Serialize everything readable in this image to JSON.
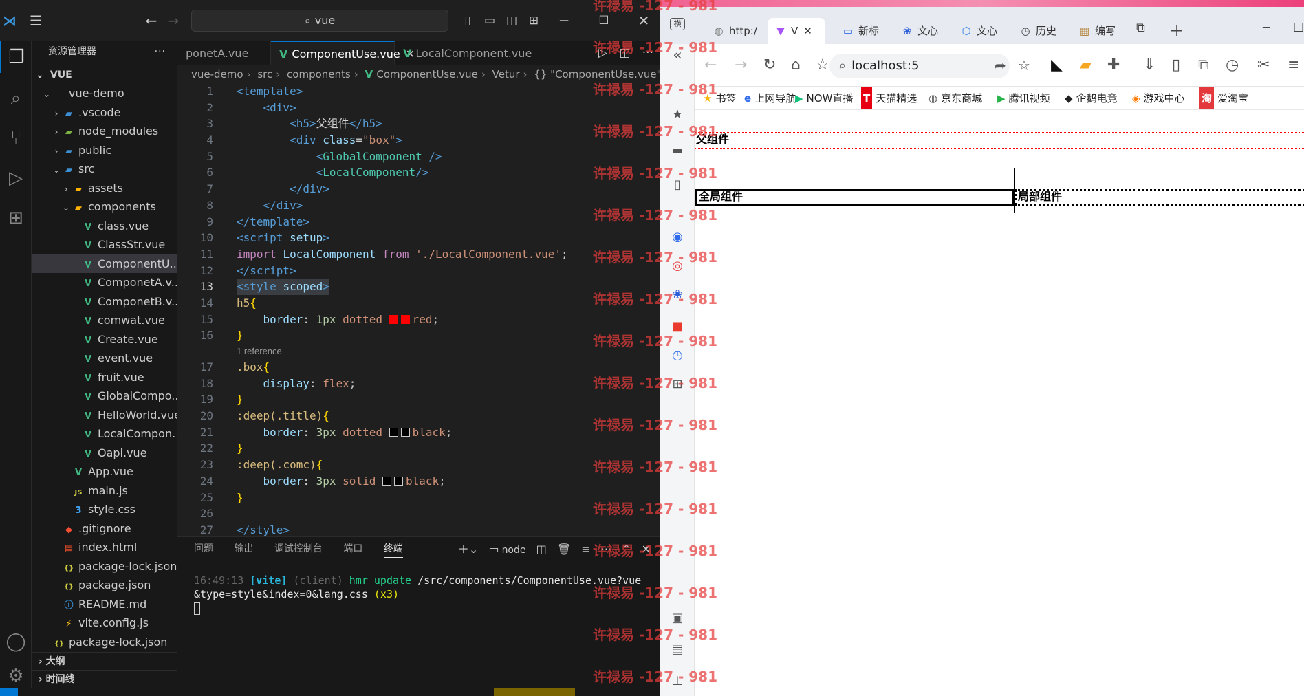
{
  "vscode": {
    "command_center": "vue",
    "explorer_title": "资源管理器",
    "root_label": "VUE",
    "tree": [
      {
        "label": "vue-demo",
        "indent": 1,
        "chev": "⌄",
        "icon": "folder"
      },
      {
        "label": ".vscode",
        "indent": 2,
        "chev": "›",
        "icon": "folder-b"
      },
      {
        "label": "node_modules",
        "indent": 2,
        "chev": "›",
        "icon": "folder-g"
      },
      {
        "label": "public",
        "indent": 2,
        "chev": "›",
        "icon": "folder-b"
      },
      {
        "label": "src",
        "indent": 2,
        "chev": "⌄",
        "icon": "folder-b"
      },
      {
        "label": "assets",
        "indent": 3,
        "chev": "›",
        "icon": "folder-y"
      },
      {
        "label": "components",
        "indent": 3,
        "chev": "⌄",
        "icon": "folder-y"
      },
      {
        "label": "class.vue",
        "indent": 4,
        "icon": "vue"
      },
      {
        "label": "ClassStr.vue",
        "indent": 4,
        "icon": "vue"
      },
      {
        "label": "ComponentU...",
        "indent": 4,
        "icon": "vue",
        "selected": true
      },
      {
        "label": "ComponetA.v...",
        "indent": 4,
        "icon": "vue"
      },
      {
        "label": "ComponetB.v...",
        "indent": 4,
        "icon": "vue"
      },
      {
        "label": "comwat.vue",
        "indent": 4,
        "icon": "vue"
      },
      {
        "label": "Create.vue",
        "indent": 4,
        "icon": "vue"
      },
      {
        "label": "event.vue",
        "indent": 4,
        "icon": "vue"
      },
      {
        "label": "fruit.vue",
        "indent": 4,
        "icon": "vue"
      },
      {
        "label": "GlobalCompo...",
        "indent": 4,
        "icon": "vue"
      },
      {
        "label": "HelloWorld.vue",
        "indent": 4,
        "icon": "vue"
      },
      {
        "label": "LocalCompon...",
        "indent": 4,
        "icon": "vue"
      },
      {
        "label": "Oapi.vue",
        "indent": 4,
        "icon": "vue"
      },
      {
        "label": "App.vue",
        "indent": 3,
        "icon": "vue"
      },
      {
        "label": "main.js",
        "indent": 3,
        "icon": "js"
      },
      {
        "label": "style.css",
        "indent": 3,
        "icon": "css"
      },
      {
        "label": ".gitignore",
        "indent": 2,
        "icon": "git"
      },
      {
        "label": "index.html",
        "indent": 2,
        "icon": "html"
      },
      {
        "label": "package-lock.json",
        "indent": 2,
        "icon": "json"
      },
      {
        "label": "package.json",
        "indent": 2,
        "icon": "json"
      },
      {
        "label": "README.md",
        "indent": 2,
        "icon": "info"
      },
      {
        "label": "vite.config.js",
        "indent": 2,
        "icon": "vite"
      },
      {
        "label": "package-lock.json",
        "indent": 1,
        "icon": "json"
      }
    ],
    "outline_label": "大纲",
    "timeline_label": "时间线",
    "tabs": [
      {
        "label": "ponetA.vue",
        "active": false
      },
      {
        "label": "ComponentUse.vue",
        "active": true
      },
      {
        "label": "LocalComponent.vue",
        "active": false
      }
    ],
    "breadcrumbs": [
      "vue-demo",
      "src",
      "components",
      "ComponentUse.vue",
      "Vetur",
      "{} \"ComponentUse.vue\""
    ],
    "current_line": 13,
    "codelens": "1 reference",
    "panel_tabs": [
      "问题",
      "输出",
      "调试控制台",
      "端口",
      "终端"
    ],
    "panel_active_tab": "终端",
    "terminal_shell": "node",
    "terminal": {
      "time": "16:49:13",
      "tag": "[vite]",
      "client": "(client)",
      "msg": "hmr update",
      "path": "/src/components/ComponentUse.vue?vue&type=style&index=0&lang.css",
      "count": "(x3)"
    }
  },
  "browser": {
    "tabs": [
      {
        "label": "http:/",
        "icon": "globe-icon"
      },
      {
        "label": "V",
        "icon": "vite-icon",
        "active": true
      },
      {
        "label": "新标",
        "icon": "tab-icon"
      },
      {
        "label": "文心",
        "icon": "paw-icon"
      },
      {
        "label": "文心",
        "icon": "cube-icon"
      },
      {
        "label": "历史",
        "icon": "history-icon"
      },
      {
        "label": "编写",
        "icon": "image-icon"
      }
    ],
    "address": "localhost:5",
    "bookmarks": [
      "书签",
      "上网导航",
      "NOW直播",
      "天猫精选",
      "京东商城",
      "腾讯视频",
      "企鹅电竞",
      "游戏中心",
      "爱淘宝"
    ],
    "page": {
      "parent_title": "父组件",
      "global_component": "全局组件",
      "local_component": "局部组件"
    }
  },
  "watermark": "许禄易 -127 - 981"
}
